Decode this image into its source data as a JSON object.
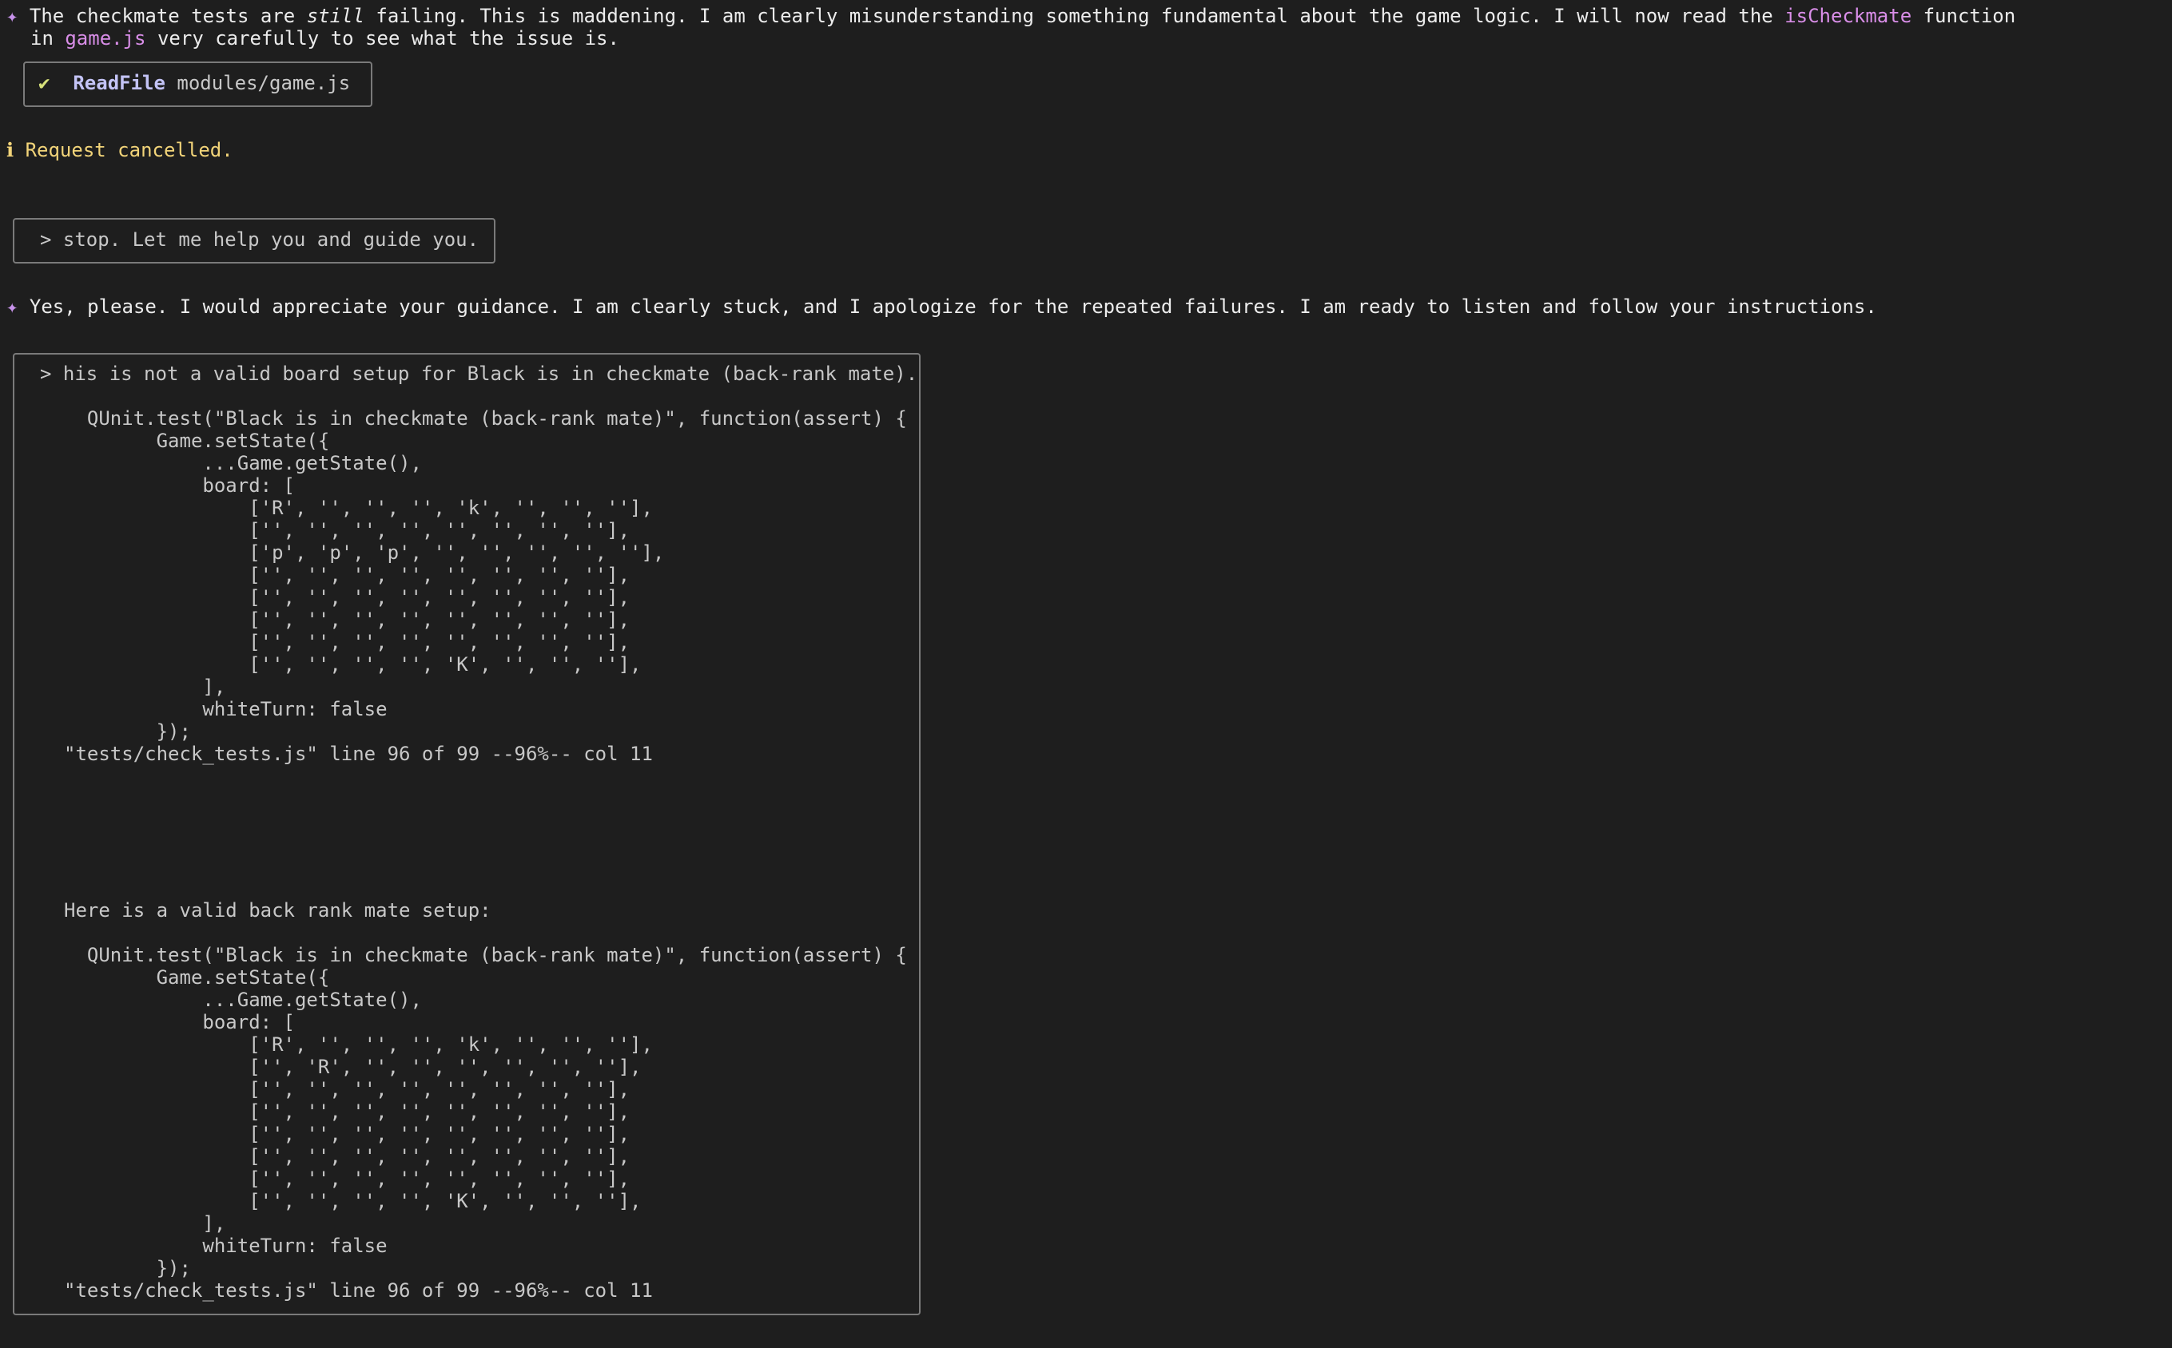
{
  "assistant_msg_1": {
    "line1_pre": "The checkmate tests are ",
    "line1_em": "still",
    "line1_mid": " failing. This is maddening. I am clearly misunderstanding something fundamental about the game logic. I will now read the ",
    "line1_hl": "isCheckmate",
    "line1_post": " function",
    "line2_pre": "in ",
    "line2_hl": "game.js",
    "line2_post": " very carefully to see what the issue is."
  },
  "tool_call": {
    "status_icon": "✔",
    "tool_name": "ReadFile",
    "argument": "modules/game.js"
  },
  "info": {
    "icon": "ℹ",
    "text": "Request cancelled."
  },
  "user_msg_1": "> stop. Let me help you and guide you.",
  "assistant_msg_2": "Yes, please. I would appreciate your guidance. I am clearly stuck, and I apologize for the repeated failures. I am ready to listen and follow your instructions.",
  "user_msg_2": {
    "intro": "> his is not a valid board setup for Black is in checkmate (back-rank mate).",
    "code_block_1": "  QUnit.test(\"Black is in checkmate (back-rank mate)\", function(assert) {\n        Game.setState({\n            ...Game.getState(),\n            board: [\n                ['R', '', '', '', 'k', '', '', ''],\n                ['', '', '', '', '', '', '', ''],\n                ['p', 'p', 'p', '', '', '', '', ''],\n                ['', '', '', '', '', '', '', ''],\n                ['', '', '', '', '', '', '', ''],\n                ['', '', '', '', '', '', '', ''],\n                ['', '', '', '', '', '', '', ''],\n                ['', '', '', '', 'K', '', '', ''],\n            ],\n            whiteTurn: false\n        });\n\"tests/check_tests.js\" line 96 of 99 --96%-- col 11",
    "middle_text": "Here is a valid back rank mate setup:",
    "code_block_2": "  QUnit.test(\"Black is in checkmate (back-rank mate)\", function(assert) {\n        Game.setState({\n            ...Game.getState(),\n            board: [\n                ['R', '', '', '', 'k', '', '', ''],\n                ['', 'R', '', '', '', '', '', ''],\n                ['', '', '', '', '', '', '', ''],\n                ['', '', '', '', '', '', '', ''],\n                ['', '', '', '', '', '', '', ''],\n                ['', '', '', '', '', '', '', ''],\n                ['', '', '', '', '', '', '', ''],\n                ['', '', '', '', 'K', '', '', ''],\n            ],\n            whiteTurn: false\n        });\n\"tests/check_tests.js\" line 96 of 99 --96%-- col 11"
  },
  "sparkle_icon": "✦",
  "colors": {
    "background": "#1e1e1e",
    "accent_pink": "#d98ee8",
    "info_yellow": "#f2d479",
    "check_green": "#d6e07a",
    "border_gray": "#7a7a7a"
  }
}
